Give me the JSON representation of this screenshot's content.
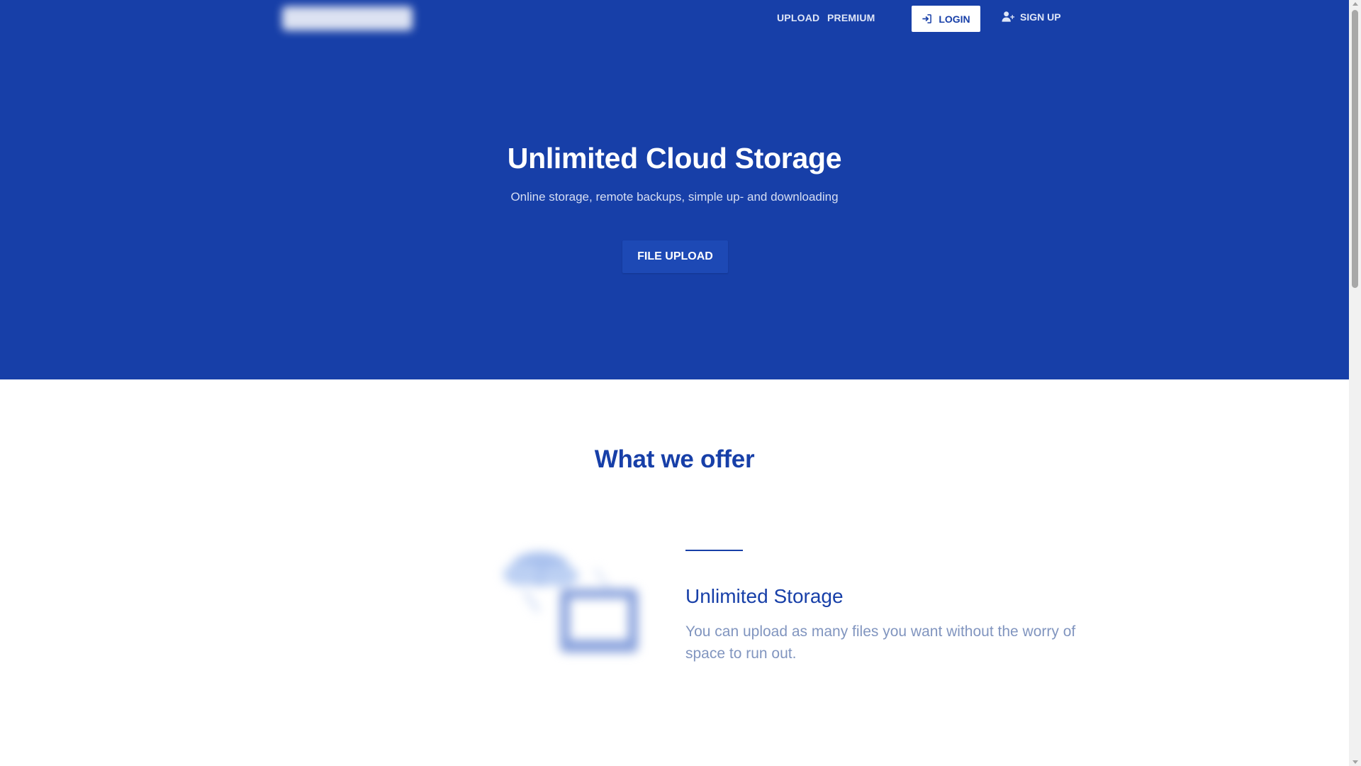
{
  "nav": {
    "upload": "UPLOAD",
    "premium": "PREMIUM",
    "login": "LOGIN",
    "signup": "SIGN UP"
  },
  "hero": {
    "title": "Unlimited Cloud Storage",
    "subtitle": "Online storage, remote backups, simple up- and downloading",
    "cta": "FILE UPLOAD"
  },
  "offer": {
    "title": "What we offer",
    "feature_title": "Unlimited Storage",
    "feature_desc": "You can upload as many files you want without the worry of space to run out."
  },
  "colors": {
    "brand_blue": "#173fa8",
    "button_blue": "#1d49b5",
    "muted_text": "#8195bf"
  },
  "icons": {
    "login": "sign-in-icon",
    "signup": "user-plus-icon",
    "illustration": "cloud-laptop-illustration"
  }
}
